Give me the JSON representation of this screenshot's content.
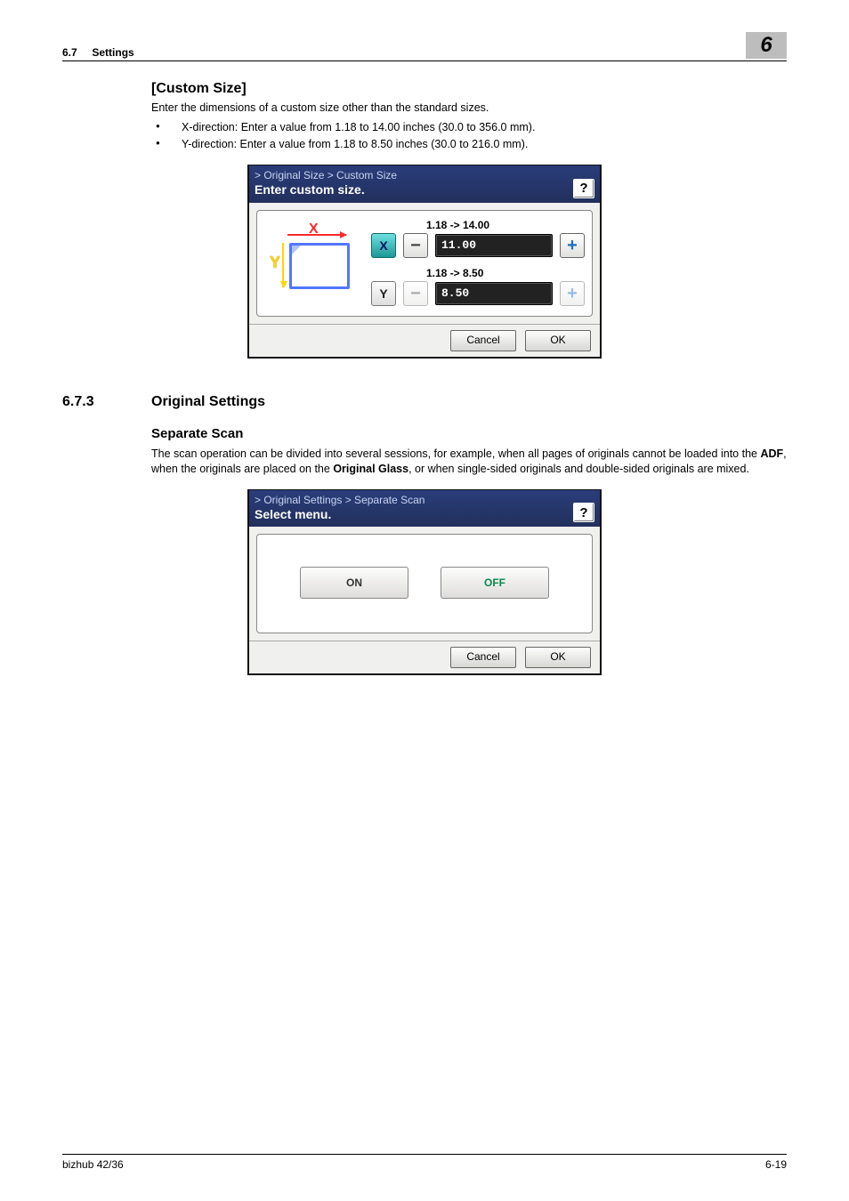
{
  "header": {
    "section_number": "6.7",
    "section_title": "Settings",
    "chapter_number": "6"
  },
  "custom_size": {
    "heading": "[Custom Size]",
    "intro": "Enter the dimensions of a custom size other than the standard sizes.",
    "bullets": [
      "X-direction: Enter a value from 1.18 to 14.00 inches (30.0 to 356.0 mm).",
      "Y-direction: Enter a value from 1.18 to 8.50 inches (30.0 to 216.0 mm)."
    ],
    "panel": {
      "breadcrumb": "> Original Size > Custom Size",
      "prompt": "Enter custom size.",
      "x": {
        "axis": "X",
        "range": "1.18 -> 14.00",
        "value": "11.00"
      },
      "y": {
        "axis": "Y",
        "range": "1.18 -> 8.50",
        "value": "8.50"
      },
      "cancel": "Cancel",
      "ok": "OK"
    }
  },
  "subsection": {
    "number": "6.7.3",
    "title": "Original Settings"
  },
  "separate_scan": {
    "heading": "Separate Scan",
    "para_pre": "The scan operation can be divided into several sessions, for example, when all pages of originals cannot be loaded into the ",
    "bold1": "ADF",
    "para_mid": ", when the originals are placed on the ",
    "bold2": "Original Glass",
    "para_post": ", or when single-sided originals and double-sided originals are mixed.",
    "panel": {
      "breadcrumb": "> Original Settings > Separate Scan",
      "prompt": "Select menu.",
      "on": "ON",
      "off": "OFF",
      "cancel": "Cancel",
      "ok": "OK"
    }
  },
  "footer": {
    "left": "bizhub 42/36",
    "right": "6-19"
  }
}
